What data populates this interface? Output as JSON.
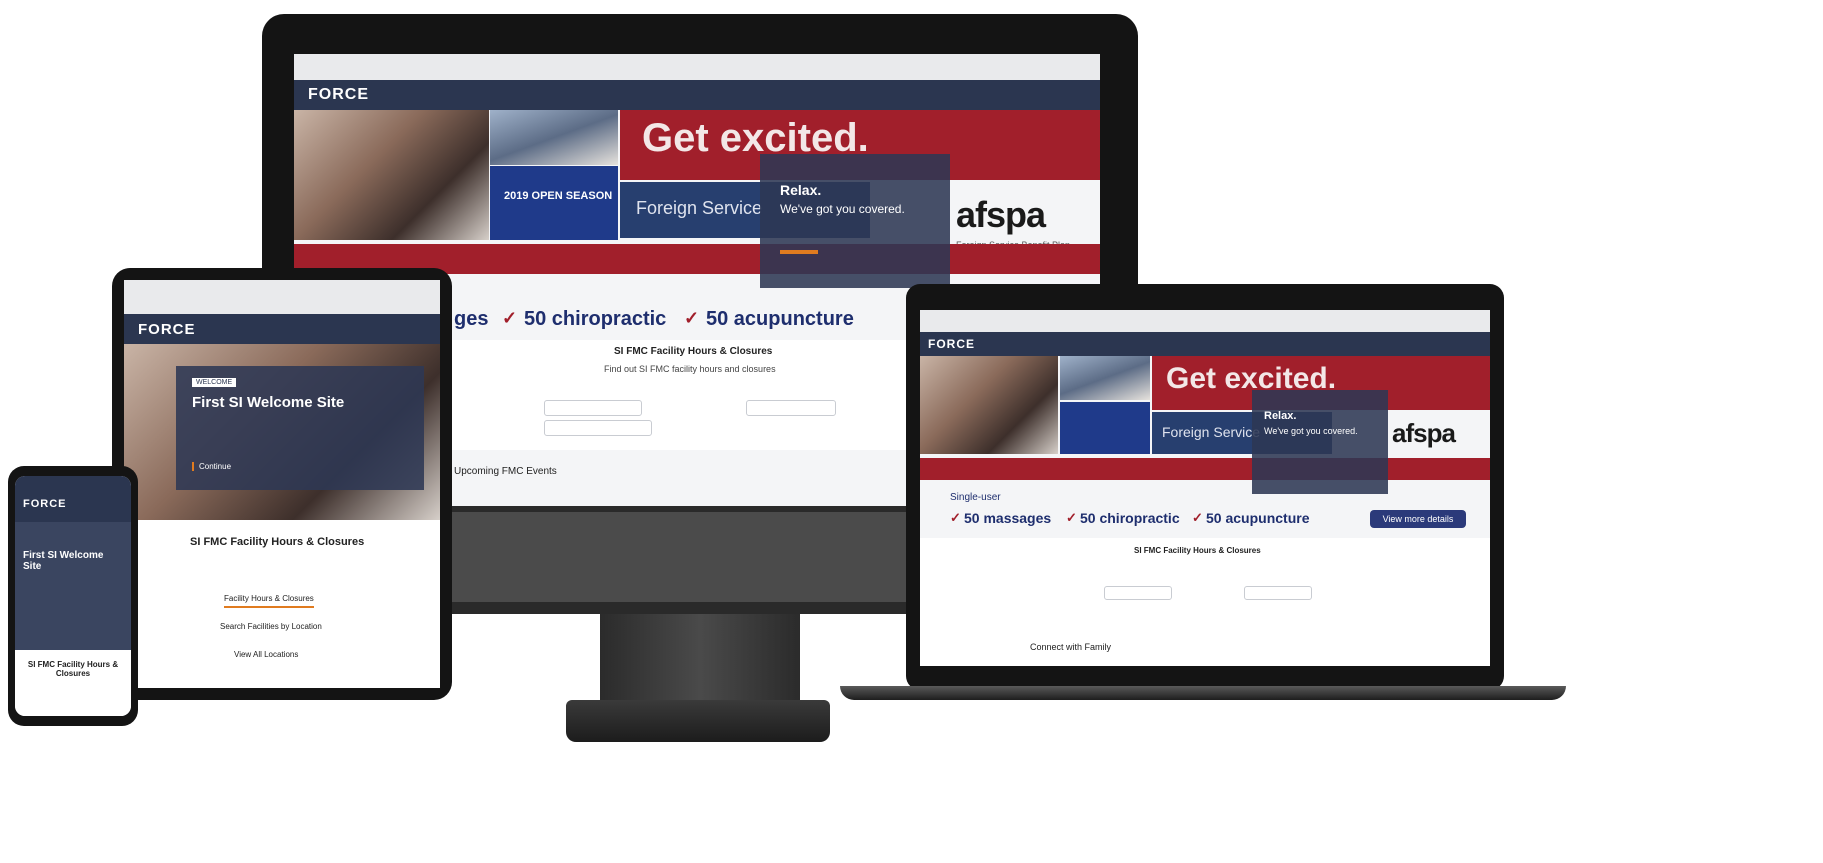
{
  "brand": {
    "logo": "FORCE"
  },
  "hero": {
    "headline": "Get excited.",
    "open_season": "2019 OPEN SEASON",
    "foreign_service": "Foreign Service",
    "relax": "Relax.",
    "relax_sub": "We've got you covered.",
    "afspa": "afspa",
    "afspa_tag": "Foreign Service Benefit Plan"
  },
  "benefits": {
    "massages": "50 massages",
    "chiropractic": "50 chiropractic",
    "acupuncture": "50 acupuncture",
    "massages_partial": "ges",
    "promo_label": "Single-user"
  },
  "tablet": {
    "badge": "WELCOME",
    "title": "First SI Welcome Site",
    "cta": "Continue",
    "section_title": "SI FMC Facility Hours & Closures",
    "link1": "Facility Hours & Closures",
    "link2": "Search Facilities by Location",
    "link3": "View All Locations"
  },
  "phone": {
    "title": "First SI Welcome Site",
    "section_title": "SI FMC Facility Hours & Closures"
  },
  "laptop": {
    "view_details": "View more details",
    "footer_link": "Connect with Family"
  },
  "monitor": {
    "facility_title": "SI FMC Facility Hours & Closures",
    "facility_sub": "Find out SI FMC facility hours and closures",
    "upcoming": "Upcoming FMC Events"
  },
  "colors": {
    "navy": "#2b3650",
    "red": "#a11f2b",
    "blue": "#1f3a8a"
  }
}
